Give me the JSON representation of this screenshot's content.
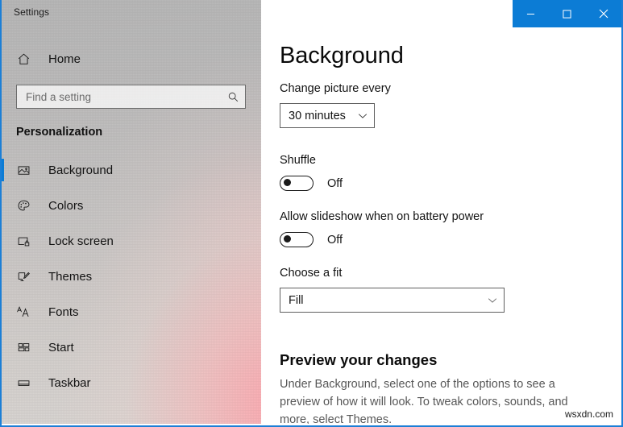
{
  "window": {
    "app_title": "Settings",
    "accent_color": "#0c7cd5",
    "caption": {
      "minimize_label": "Minimize",
      "maximize_label": "Maximize",
      "close_label": "Close"
    }
  },
  "sidebar": {
    "home_label": "Home",
    "search": {
      "placeholder": "Find a setting",
      "value": "",
      "icon": "search-icon"
    },
    "category_heading": "Personalization",
    "items": [
      {
        "label": "Background",
        "icon": "picture-icon",
        "selected": true
      },
      {
        "label": "Colors",
        "icon": "palette-icon",
        "selected": false
      },
      {
        "label": "Lock screen",
        "icon": "lock-screen-icon",
        "selected": false
      },
      {
        "label": "Themes",
        "icon": "brush-icon",
        "selected": false
      },
      {
        "label": "Fonts",
        "icon": "fonts-icon",
        "selected": false
      },
      {
        "label": "Start",
        "icon": "start-icon",
        "selected": false
      },
      {
        "label": "Taskbar",
        "icon": "taskbar-icon",
        "selected": false
      }
    ]
  },
  "main": {
    "page_title": "Background",
    "change_picture": {
      "label": "Change picture every",
      "value": "30 minutes",
      "arrow_icon": "chevron-down-icon"
    },
    "shuffle": {
      "label": "Shuffle",
      "state": "Off"
    },
    "battery_slideshow": {
      "label": "Allow slideshow when on battery power",
      "state": "Off"
    },
    "choose_fit": {
      "label": "Choose a fit",
      "value": "Fill",
      "arrow_icon": "chevron-down-icon"
    },
    "preview": {
      "heading": "Preview your changes",
      "description": "Under Background, select one of the options to see a preview of how it will look. To tweak colors, sounds, and more, select Themes."
    }
  },
  "watermark": {
    "text": "wsxdn.com"
  }
}
